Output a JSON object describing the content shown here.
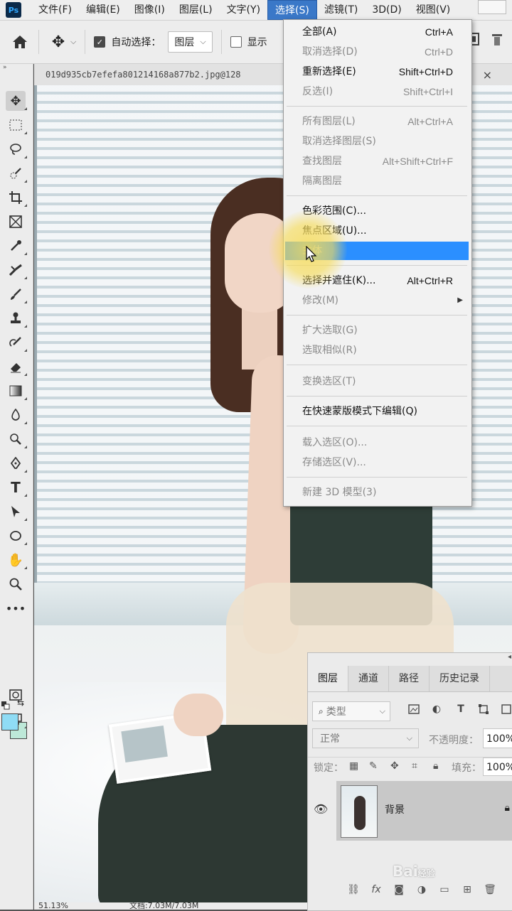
{
  "app": {
    "logo": "Ps"
  },
  "menubar": {
    "items": [
      "文件(F)",
      "编辑(E)",
      "图像(I)",
      "图层(L)",
      "文字(Y)",
      "选择(S)",
      "滤镜(T)",
      "3D(D)",
      "视图(V)"
    ],
    "active_index": 5
  },
  "options_bar": {
    "auto_select_label": "自动选择：",
    "auto_select_checked": true,
    "auto_select_target": "图层",
    "show_label": "显示"
  },
  "document": {
    "tab_title": "019d935cb7efefa801214168a877b2.jpg@128",
    "close_glyph": "×"
  },
  "select_menu": {
    "items": [
      {
        "label": "全部(A)",
        "shortcut": "Ctrl+A",
        "enabled": true
      },
      {
        "label": "取消选择(D)",
        "shortcut": "Ctrl+D",
        "enabled": false
      },
      {
        "label": "重新选择(E)",
        "shortcut": "Shift+Ctrl+D",
        "enabled": true
      },
      {
        "label": "反选(I)",
        "shortcut": "Shift+Ctrl+I",
        "enabled": false
      },
      {
        "label": "所有图层(L)",
        "shortcut": "Alt+Ctrl+A",
        "enabled": false
      },
      {
        "label": "取消选择图层(S)",
        "shortcut": "",
        "enabled": false
      },
      {
        "label": "查找图层",
        "shortcut": "Alt+Shift+Ctrl+F",
        "enabled": false
      },
      {
        "label": "隔离图层",
        "shortcut": "",
        "enabled": false
      },
      {
        "label": "色彩范围(C)...",
        "shortcut": "",
        "enabled": true
      },
      {
        "label": "焦点区域(U)...",
        "shortcut": "",
        "enabled": true
      },
      {
        "label": "主体",
        "shortcut": "",
        "enabled": true,
        "highlighted": true
      },
      {
        "label": "选择并遮住(K)...",
        "shortcut": "Alt+Ctrl+R",
        "enabled": true
      },
      {
        "label": "修改(M)",
        "shortcut": "",
        "enabled": false,
        "submenu": true
      },
      {
        "label": "扩大选取(G)",
        "shortcut": "",
        "enabled": false
      },
      {
        "label": "选取相似(R)",
        "shortcut": "",
        "enabled": false
      },
      {
        "label": "变换选区(T)",
        "shortcut": "",
        "enabled": false
      },
      {
        "label": "在快速蒙版模式下编辑(Q)",
        "shortcut": "",
        "enabled": true
      },
      {
        "label": "载入选区(O)...",
        "shortcut": "",
        "enabled": false
      },
      {
        "label": "存储选区(V)...",
        "shortcut": "",
        "enabled": false
      },
      {
        "label": "新建 3D 模型(3)",
        "shortcut": "",
        "enabled": false
      }
    ]
  },
  "layers_panel": {
    "tabs": [
      "图层",
      "通道",
      "路径",
      "历史记录"
    ],
    "active_tab": 0,
    "kind_label": "类型",
    "blend_mode": "正常",
    "opacity_label": "不透明度：",
    "opacity_value": "100%",
    "lock_label": "锁定：",
    "fill_label": "填充：",
    "fill_value": "100%",
    "layer_name": "背景"
  },
  "status": {
    "zoom": "51.13%",
    "doc_size": "文档:7.03M/7.03M"
  },
  "watermark": {
    "text": "Bai",
    "sub": "经验"
  },
  "colors": {
    "foreground": "#8fdcf5",
    "background": "#bde8d8",
    "menu_highlight": "#2b8fff"
  }
}
